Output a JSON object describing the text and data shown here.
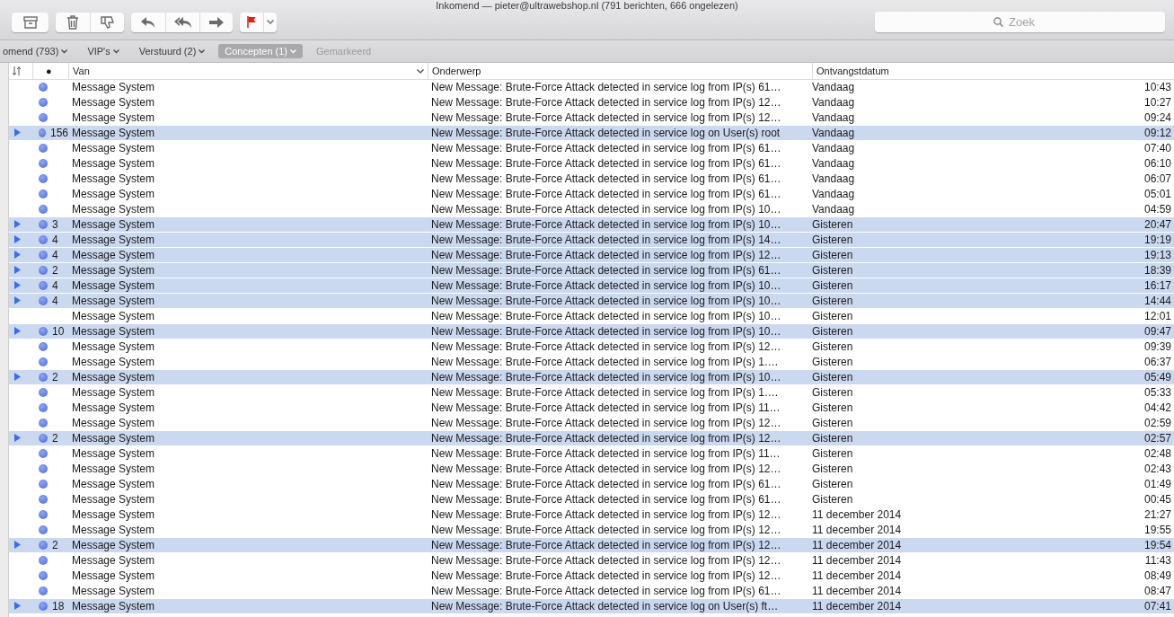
{
  "window": {
    "title": "Inkomend — pieter@ultrawebshop.nl (791 berichten, 666 ongelezen)"
  },
  "search": {
    "placeholder": "Zoek"
  },
  "mailboxes": [
    {
      "label": "omend (793)",
      "selected": false,
      "menu": true
    },
    {
      "label": "VIP's",
      "selected": false,
      "menu": true
    },
    {
      "label": "Verstuurd (2)",
      "selected": false,
      "menu": true
    },
    {
      "label": "Concepten (1)",
      "selected": true,
      "menu": true
    },
    {
      "label": "Gemarkeerd",
      "selected": false,
      "menu": false
    }
  ],
  "columns": {
    "unread": "●",
    "from": "Van",
    "subject": "Onderwerp",
    "date": "Ontvangstdatum"
  },
  "rows": [
    {
      "kind": "message",
      "unread": true,
      "from": "Message System",
      "subject": "New Message: Brute-Force Attack detected in service log from IP(s) 61…",
      "date": "Vandaag",
      "time": "10:43"
    },
    {
      "kind": "message",
      "unread": true,
      "from": "Message System",
      "subject": "New Message: Brute-Force Attack detected in service log from IP(s) 12…",
      "date": "Vandaag",
      "time": "10:27"
    },
    {
      "kind": "message",
      "unread": true,
      "from": "Message System",
      "subject": "New Message: Brute-Force Attack detected in service log from IP(s) 12…",
      "date": "Vandaag",
      "time": "09:24"
    },
    {
      "kind": "thread",
      "count": "156",
      "unread": true,
      "from": "Message System",
      "subject": "New Message: Brute-Force Attack detected in service log on User(s) root",
      "date": "Vandaag",
      "time": "09:12"
    },
    {
      "kind": "message",
      "unread": true,
      "from": "Message System",
      "subject": "New Message: Brute-Force Attack detected in service log from IP(s) 61…",
      "date": "Vandaag",
      "time": "07:40"
    },
    {
      "kind": "message",
      "unread": true,
      "from": "Message System",
      "subject": "New Message: Brute-Force Attack detected in service log from IP(s) 61…",
      "date": "Vandaag",
      "time": "06:10"
    },
    {
      "kind": "message",
      "unread": true,
      "from": "Message System",
      "subject": "New Message: Brute-Force Attack detected in service log from IP(s) 61…",
      "date": "Vandaag",
      "time": "06:07"
    },
    {
      "kind": "message",
      "unread": true,
      "from": "Message System",
      "subject": "New Message: Brute-Force Attack detected in service log from IP(s) 61…",
      "date": "Vandaag",
      "time": "05:01"
    },
    {
      "kind": "message",
      "unread": true,
      "from": "Message System",
      "subject": "New Message: Brute-Force Attack detected in service log from IP(s) 10…",
      "date": "Vandaag",
      "time": "04:59"
    },
    {
      "kind": "thread",
      "count": "3",
      "unread": true,
      "from": "Message System",
      "subject": "New Message: Brute-Force Attack detected in service log from IP(s) 10…",
      "date": "Gisteren",
      "time": "20:47"
    },
    {
      "kind": "thread",
      "count": "4",
      "unread": true,
      "from": "Message System",
      "subject": "New Message: Brute-Force Attack detected in service log from IP(s) 14…",
      "date": "Gisteren",
      "time": "19:19"
    },
    {
      "kind": "thread",
      "count": "4",
      "unread": true,
      "from": "Message System",
      "subject": "New Message: Brute-Force Attack detected in service log from IP(s) 12…",
      "date": "Gisteren",
      "time": "19:13"
    },
    {
      "kind": "thread",
      "count": "2",
      "unread": true,
      "from": "Message System",
      "subject": "New Message: Brute-Force Attack detected in service log from IP(s) 61…",
      "date": "Gisteren",
      "time": "18:39"
    },
    {
      "kind": "thread",
      "count": "4",
      "unread": true,
      "from": "Message System",
      "subject": "New Message: Brute-Force Attack detected in service log from IP(s) 10…",
      "date": "Gisteren",
      "time": "16:17"
    },
    {
      "kind": "thread",
      "count": "4",
      "unread": true,
      "from": "Message System",
      "subject": "New Message: Brute-Force Attack detected in service log from IP(s) 10…",
      "date": "Gisteren",
      "time": "14:44"
    },
    {
      "kind": "message",
      "unread": false,
      "from": "Message System",
      "subject": "New Message: Brute-Force Attack detected in service log from IP(s) 10…",
      "date": "Gisteren",
      "time": "12:01"
    },
    {
      "kind": "thread",
      "count": "10",
      "unread": true,
      "from": "Message System",
      "subject": "New Message: Brute-Force Attack detected in service log from IP(s) 10…",
      "date": "Gisteren",
      "time": "09:47"
    },
    {
      "kind": "message",
      "unread": true,
      "from": "Message System",
      "subject": "New Message: Brute-Force Attack detected in service log from IP(s) 12…",
      "date": "Gisteren",
      "time": "09:39"
    },
    {
      "kind": "message",
      "unread": true,
      "from": "Message System",
      "subject": "New Message: Brute-Force Attack detected in service log from IP(s) 1….",
      "date": "Gisteren",
      "time": "06:37"
    },
    {
      "kind": "thread",
      "count": "2",
      "unread": true,
      "from": "Message System",
      "subject": "New Message: Brute-Force Attack detected in service log from IP(s) 10…",
      "date": "Gisteren",
      "time": "05:49"
    },
    {
      "kind": "message",
      "unread": true,
      "from": "Message System",
      "subject": "New Message: Brute-Force Attack detected in service log from IP(s) 1….",
      "date": "Gisteren",
      "time": "05:33"
    },
    {
      "kind": "message",
      "unread": true,
      "from": "Message System",
      "subject": "New Message: Brute-Force Attack detected in service log from IP(s) 11…",
      "date": "Gisteren",
      "time": "04:42"
    },
    {
      "kind": "message",
      "unread": true,
      "from": "Message System",
      "subject": "New Message: Brute-Force Attack detected in service log from IP(s) 12…",
      "date": "Gisteren",
      "time": "02:59"
    },
    {
      "kind": "thread",
      "count": "2",
      "unread": true,
      "from": "Message System",
      "subject": "New Message: Brute-Force Attack detected in service log from IP(s) 12…",
      "date": "Gisteren",
      "time": "02:57"
    },
    {
      "kind": "message",
      "unread": true,
      "from": "Message System",
      "subject": "New Message: Brute-Force Attack detected in service log from IP(s) 11…",
      "date": "Gisteren",
      "time": "02:48"
    },
    {
      "kind": "message",
      "unread": true,
      "from": "Message System",
      "subject": "New Message: Brute-Force Attack detected in service log from IP(s) 12…",
      "date": "Gisteren",
      "time": "02:43"
    },
    {
      "kind": "message",
      "unread": true,
      "from": "Message System",
      "subject": "New Message: Brute-Force Attack detected in service log from IP(s) 61…",
      "date": "Gisteren",
      "time": "01:49"
    },
    {
      "kind": "message",
      "unread": true,
      "from": "Message System",
      "subject": "New Message: Brute-Force Attack detected in service log from IP(s) 61…",
      "date": "Gisteren",
      "time": "00:45"
    },
    {
      "kind": "message",
      "unread": true,
      "from": "Message System",
      "subject": "New Message: Brute-Force Attack detected in service log from IP(s) 12…",
      "date": "11 december 2014",
      "time": "21:27"
    },
    {
      "kind": "message",
      "unread": true,
      "from": "Message System",
      "subject": "New Message: Brute-Force Attack detected in service log from IP(s) 12…",
      "date": "11 december 2014",
      "time": "19:55"
    },
    {
      "kind": "thread",
      "count": "2",
      "unread": true,
      "from": "Message System",
      "subject": "New Message: Brute-Force Attack detected in service log from IP(s) 12…",
      "date": "11 december 2014",
      "time": "19:54"
    },
    {
      "kind": "message",
      "unread": true,
      "from": "Message System",
      "subject": "New Message: Brute-Force Attack detected in service log from IP(s) 12…",
      "date": "11 december 2014",
      "time": "11:43"
    },
    {
      "kind": "message",
      "unread": true,
      "from": "Message System",
      "subject": "New Message: Brute-Force Attack detected in service log from IP(s) 12…",
      "date": "11 december 2014",
      "time": "08:49"
    },
    {
      "kind": "message",
      "unread": true,
      "from": "Message System",
      "subject": "New Message: Brute-Force Attack detected in service log from IP(s) 61…",
      "date": "11 december 2014",
      "time": "08:47"
    },
    {
      "kind": "thread",
      "count": "18",
      "unread": true,
      "from": "Message System",
      "subject": "New Message: Brute-Force Attack detected in service log on User(s) ft…",
      "date": "11 december 2014",
      "time": "07:41"
    }
  ]
}
